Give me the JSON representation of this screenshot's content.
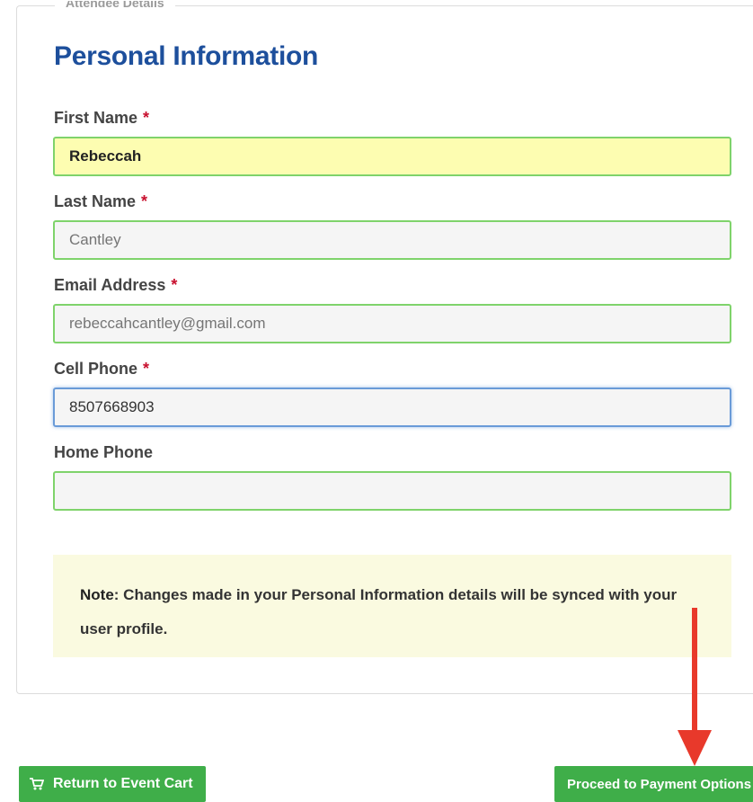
{
  "fieldset": {
    "legend": "Attendee Details"
  },
  "section_title": "Personal Information",
  "required_marker": "*",
  "fields": {
    "first_name": {
      "label": "First Name",
      "value": "Rebeccah"
    },
    "last_name": {
      "label": "Last Name",
      "placeholder": "Cantley"
    },
    "email": {
      "label": "Email Address",
      "placeholder": "rebeccahcantley@gmail.com"
    },
    "cell_phone": {
      "label": "Cell Phone",
      "value": "8507668903"
    },
    "home_phone": {
      "label": "Home Phone",
      "value": ""
    }
  },
  "note": {
    "strong": "Note",
    "text": ": Changes made in your Personal Information details will be synced with your user profile."
  },
  "buttons": {
    "return_label": "Return to Event Cart",
    "proceed_label": "Proceed to Payment Options"
  },
  "colors": {
    "title": "#1d4f9c",
    "required": "#c8102e",
    "input_border": "#7fd36b",
    "autofill": "#fdfdb1",
    "note_bg": "#fafae0",
    "button": "#3fae49",
    "annotation_arrow": "#e8392b"
  },
  "icons": {
    "cart": "shopping-cart-icon",
    "annotation": "red-arrow-annotation"
  }
}
